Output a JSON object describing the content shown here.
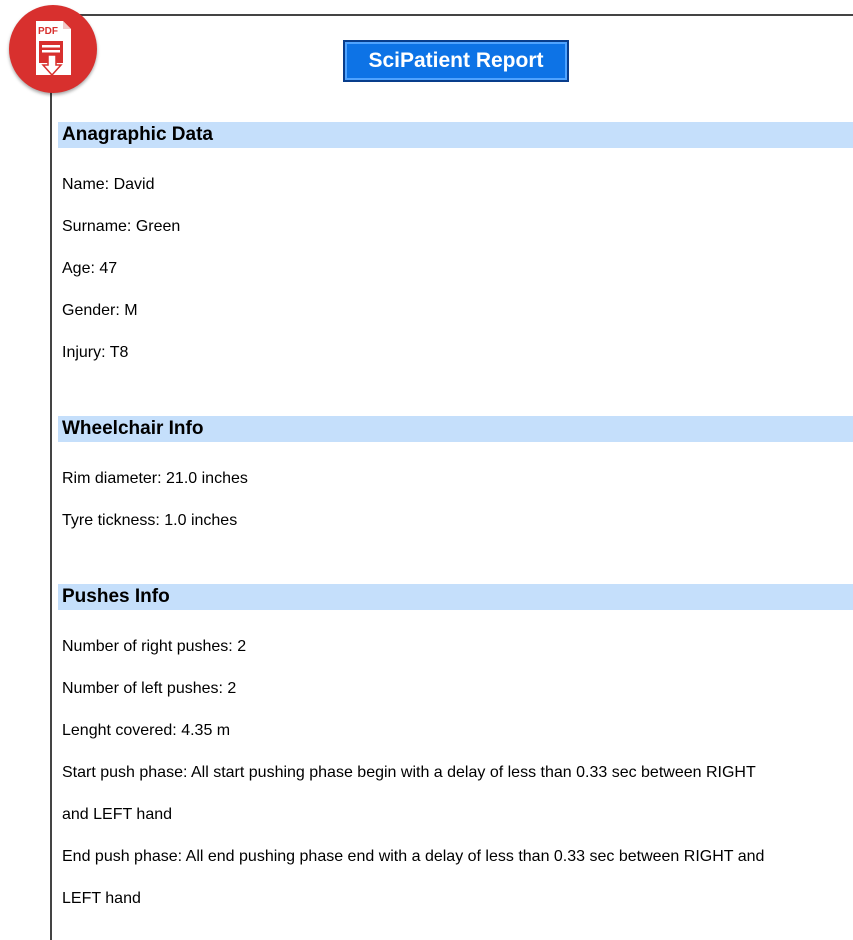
{
  "badge": {
    "text": "PDF",
    "icon": "pdf-download-icon",
    "color": "#d8302e"
  },
  "title": "SciPatient Report",
  "sections": {
    "anagraphic": {
      "header": "Anagraphic Data",
      "name": "Name: David",
      "surname": "Surname: Green",
      "age": "Age: 47",
      "gender": "Gender: M",
      "injury": "Injury: T8"
    },
    "wheelchair": {
      "header": "Wheelchair Info",
      "rim": "Rim diameter: 21.0 inches",
      "tyre": "Tyre tickness: 1.0 inches"
    },
    "pushes": {
      "header": "Pushes Info",
      "right": "Number of right pushes: 2",
      "left": "Number of left pushes: 2",
      "length": "Lenght covered: 4.35 m",
      "start_line1": "Start push phase: All start pushing phase begin with a delay of less than 0.33 sec between RIGHT",
      "start_line2": "and LEFT hand",
      "end_line1": "End push phase: All end pushing phase end with a delay of less than 0.33 sec between RIGHT and",
      "end_line2": "LEFT hand"
    }
  },
  "colors": {
    "section_bg": "#c5dffb",
    "title_bg": "#0d73e6",
    "title_border": "#083d8c"
  }
}
